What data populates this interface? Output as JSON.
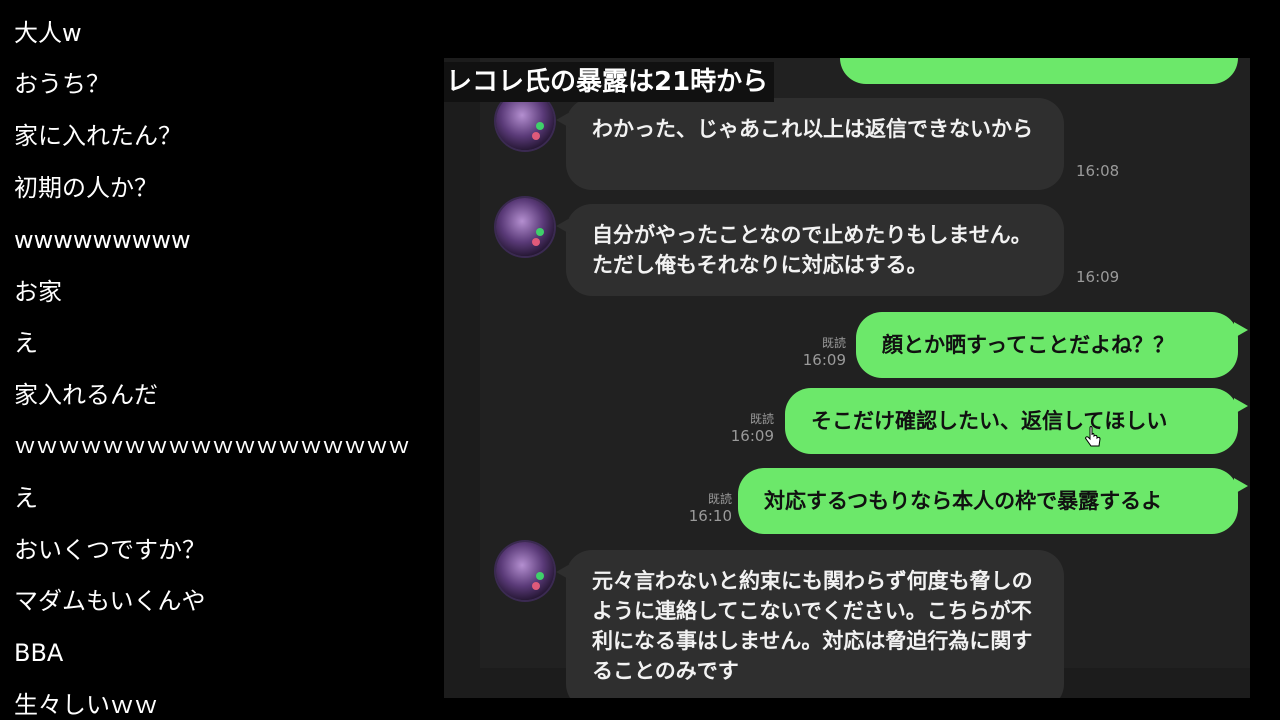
{
  "comments": [
    "大人w",
    "おうち？",
    "家に入れたん？",
    "初期の人か？",
    "wwwwwwwww",
    "お家",
    "え",
    "家入れるんだ",
    "ｗｗｗｗｗｗｗｗｗｗｗｗｗｗｗｗｗｗ",
    "え",
    "おいくつですか？",
    "マダムもいくんや",
    "BBA",
    "生々しいｗｗ"
  ],
  "overlay": {
    "title": "レコレ氏の暴露は21時から"
  },
  "chat": {
    "messages": [
      {
        "text": "わかった、じゃあこれ以上は返信できないから",
        "time": "16:08"
      },
      {
        "text": "自分がやったことなので止めたりもしません。ただし俺もそれなりに対応はする。",
        "time": "16:09"
      },
      {
        "text": "顔とか晒すってことだよね？？",
        "read": "既読",
        "time": "16:09"
      },
      {
        "text": "そこだけ確認したい、返信してほしい",
        "read": "既読",
        "time": "16:09"
      },
      {
        "text": "対応するつもりなら本人の枠で暴露するよ",
        "read": "既読",
        "time": "16:10"
      },
      {
        "text": "元々言わないと約束にも関わらず何度も脅しのように連絡してこないでください。こちらが不利になる事はしません。対応は脅迫行為に関することのみです"
      }
    ]
  },
  "colors": {
    "incoming": "#2f2f2f",
    "outgoing": "#6ce86a",
    "background": "#000000"
  }
}
